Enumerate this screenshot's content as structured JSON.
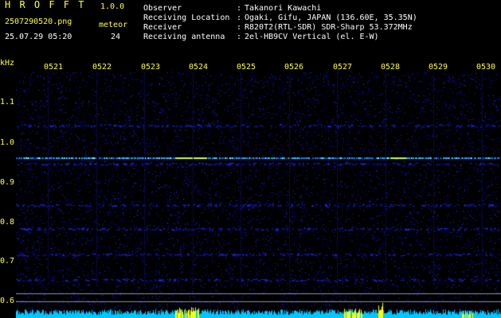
{
  "header": {
    "app_title": "H R O F F T",
    "version": "1.0.0",
    "filename": "2507290520.png",
    "timestamp": "25.07.29 05:20",
    "meteor_label": "meteor",
    "meteor_count": "24"
  },
  "station_info": [
    {
      "label": "Observer",
      "value": "Takanori Kawachi"
    },
    {
      "label": "Receiving Location",
      "value": "Ogaki, Gifu, JAPAN (136.60E, 35.35N)"
    },
    {
      "label": "Receiver",
      "value": "R820T2(RTL-SDR) SDR-Sharp 53.372MHz"
    },
    {
      "label": "Receiving antenna",
      "value": "2el-HB9CV Vertical (el. E-W)"
    }
  ],
  "axis": {
    "y_unit": "kHz",
    "y_ticks": [
      "1.1",
      "1.0",
      "0.9",
      "0.8",
      "0.7",
      "0.6"
    ],
    "x_ticks": [
      "0521",
      "0522",
      "0523",
      "0524",
      "0525",
      "0526",
      "0527",
      "0528",
      "0529",
      "0530"
    ]
  },
  "colors": {
    "label_yellow": "#ffff40",
    "text_white": "#ffffff",
    "background": "#000000",
    "noise_blue": "#1a1aff",
    "signal_cyan": "#00ffff",
    "burst_yellow": "#ffff00"
  }
}
